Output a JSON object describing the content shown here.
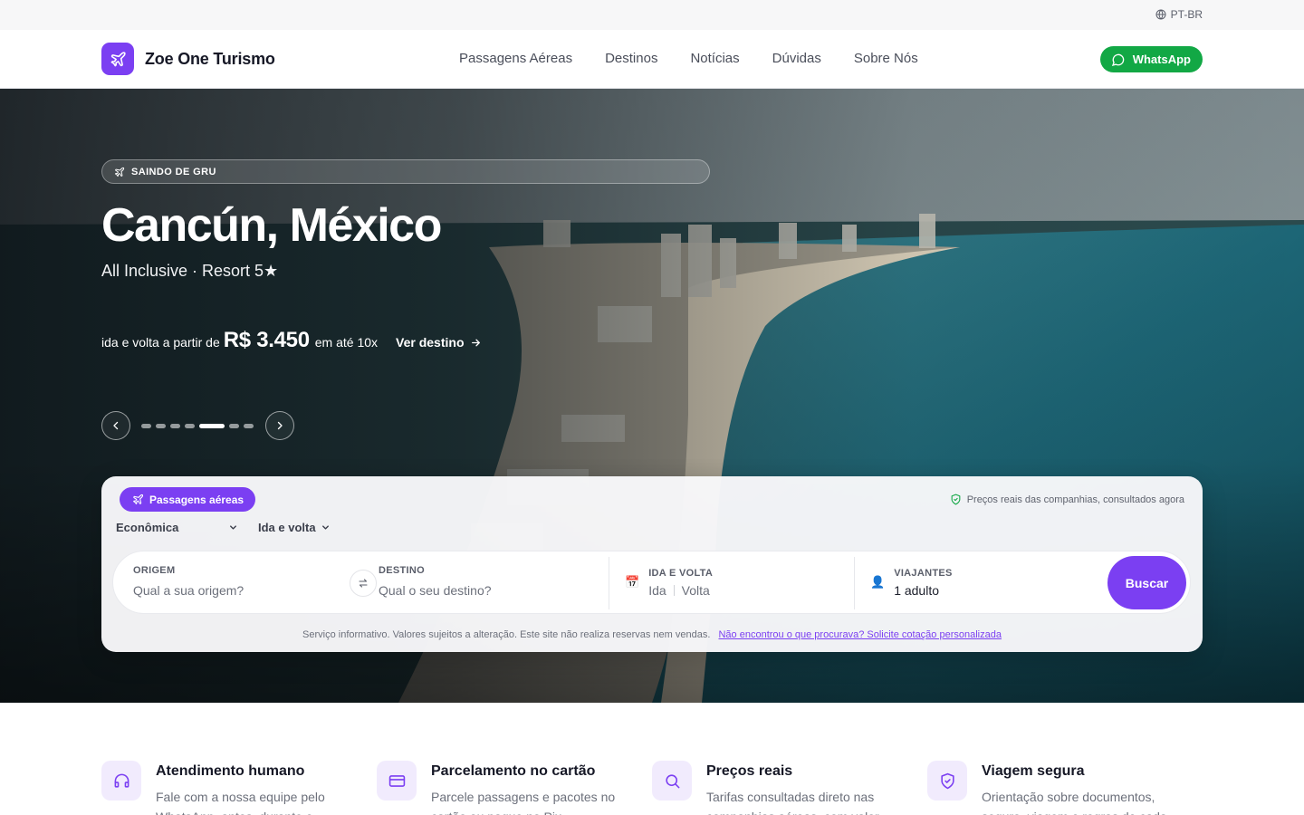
{
  "topbar": {
    "language": "PT-BR"
  },
  "header": {
    "brand": "Zoe One Turismo",
    "nav": [
      "Passagens Aéreas",
      "Destinos",
      "Notícias",
      "Dúvidas",
      "Sobre Nós"
    ],
    "whatsapp_label": "WhatsApp"
  },
  "hero": {
    "origin_badge": "SAINDO DE GRU",
    "destination": "Cancún, México",
    "subtitle": "All Inclusive · Resort 5★",
    "price_prefix": "ida e volta a partir de",
    "price": "R$ 3.450",
    "installments": "em até 10x",
    "cta": "Ver destino",
    "slides_total": 7,
    "active_slide": 5
  },
  "search": {
    "mode": "Passagens aéreas",
    "trust_note": "Preços reais das companhias, consultados agora",
    "cabin_class": "Econômica",
    "trip_type": "Ida e volta",
    "origin_label": "ORIGEM",
    "origin_placeholder": "Qual a sua origem?",
    "destination_label": "DESTINO",
    "destination_placeholder": "Qual o seu destino?",
    "dates_label": "IDA E VOLTA",
    "depart_placeholder": "Ida",
    "return_placeholder": "Volta",
    "travelers_label": "VIAJANTES",
    "travelers_value": "1 adulto",
    "search_button": "Buscar",
    "disclaimer": "Serviço informativo. Valores sujeitos a alteração. Este site não realiza reservas nem vendas.",
    "custom_quote_link": "Não encontrou o que procurava? Solicite cotação personalizada"
  },
  "features": [
    {
      "icon": "headset-icon",
      "title": "Atendimento humano",
      "desc": "Fale com a nossa equipe pelo WhatsApp, antes, durante e"
    },
    {
      "icon": "credit-card-icon",
      "title": "Parcelamento no cartão",
      "desc": "Parcele passagens e pacotes no cartão ou pague no Pix"
    },
    {
      "icon": "search-icon",
      "title": "Preços reais",
      "desc": "Tarifas consultadas direto nas companhias aéreas, com valor"
    },
    {
      "icon": "shield-check-icon",
      "title": "Viagem segura",
      "desc": "Orientação sobre documentos, seguro, viagem e regras de cada"
    }
  ],
  "colors": {
    "accent": "#7b3ff2",
    "whatsapp": "#12a845",
    "accent_soft": "#f1ebfd"
  }
}
